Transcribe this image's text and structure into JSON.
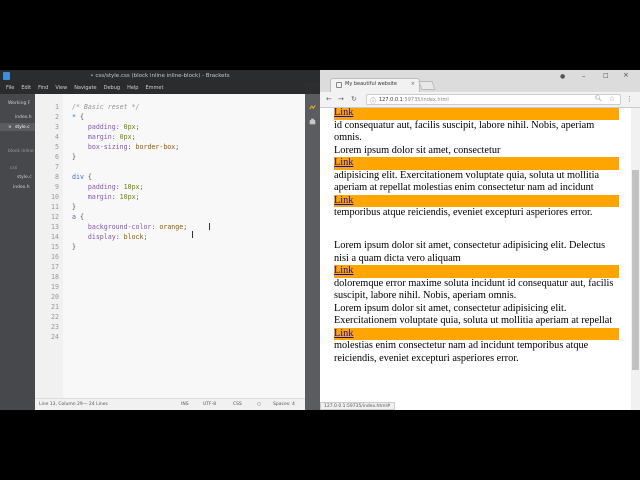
{
  "brackets": {
    "title": "• css/style.css (block inline inline-block) - Brackets",
    "menu": [
      "File",
      "Edit",
      "Find",
      "View",
      "Navigate",
      "Debug",
      "Help",
      "Emmet"
    ],
    "sidebar": {
      "working_files_label": "Working F",
      "working_files": [
        "index.h",
        "style.c"
      ],
      "project_label": "block inline",
      "folder": "css",
      "tree_file": "style.c",
      "tree_index": "index.h"
    },
    "line_numbers": [
      "1",
      "2",
      "3",
      "4",
      "5",
      "6",
      "7",
      "8",
      "9",
      "10",
      "11",
      "12",
      "13",
      "14",
      "15",
      "16",
      "17",
      "18",
      "19",
      "20",
      "21",
      "22",
      "23",
      "24"
    ],
    "code": {
      "l1": "/* Basic reset */",
      "l2_sel": "*",
      "l2_brace": " {",
      "l3_prop": "padding",
      "l3_val": "0px",
      "l4_prop": "margin",
      "l4_val": "0px",
      "l5_prop": "box-sizing",
      "l5_val": "border-box",
      "l6": "}",
      "l8_sel": "div",
      "l8_brace": " {",
      "l9_prop": "padding",
      "l9_val": "10px",
      "l10_prop": "margin",
      "l10_val": "10px",
      "l11": "}",
      "l12_sel": "a",
      "l12_brace": " {",
      "l13_prop": "background-color",
      "l13_val": "orange",
      "l14_prop": "display",
      "l14_val": "block",
      "l15": "}"
    },
    "status": {
      "position": "Line 13, Column 29",
      "lines": "— 24 Lines",
      "mode": "INS",
      "encoding": "UTF-8",
      "language": "CSS",
      "spaces": "Spaces: 4"
    }
  },
  "chrome": {
    "tab_title": "My beautiful website",
    "tab_close": "×",
    "url_host": "127.0.0.1",
    "url_rest": ":59735/index.html",
    "status_url": "127.0.0.1:59735/index.html#",
    "page": {
      "link_label": "Link",
      "texts": [
        "id consequatur aut, facilis suscipit, labore nihil. Nobis, aperiam omnis.",
        "Lorem ipsum dolor sit amet, consectetur",
        "adipisicing elit. Exercitationem voluptate quia, soluta ut mollitia aperiam at repellat molestias enim consectetur nam ad incidunt",
        "temporibus atque reiciendis, eveniet excepturi asperiores error.",
        "Lorem ipsum dolor sit amet, consectetur adipisicing elit. Delectus nisi a quam dicta vero aliquam",
        "doloremque error maxime soluta incidunt id consequatur aut, facilis suscipit, labore nihil. Nobis, aperiam omnis.",
        "Lorem ipsum dolor sit amet, consectetur adipisicing elit. Exercitationem voluptate quia, soluta ut mollitia aperiam at repellat",
        "molestias enim consectetur nam ad incidunt temporibus atque reiciendis, eveniet excepturi asperiores error."
      ]
    }
  },
  "colors": {
    "link_bg": "#ffa500",
    "editor_bg": "#f8f8f8",
    "sidebar_bg": "#47484b"
  }
}
